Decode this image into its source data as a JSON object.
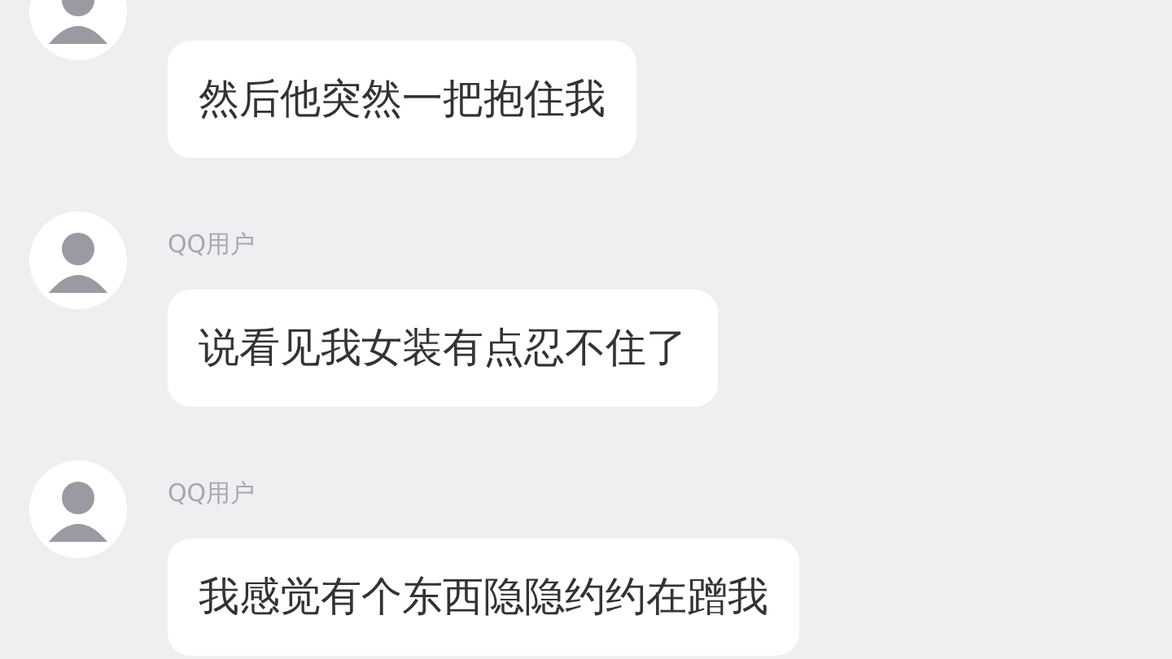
{
  "messages": [
    {
      "text": "然后他突然一把抱住我"
    },
    {
      "sender": "QQ用户",
      "text": "说看见我女装有点忍不住了"
    },
    {
      "sender": "QQ用户",
      "text": "我感觉有个东西隐隐约约在蹭我"
    }
  ]
}
